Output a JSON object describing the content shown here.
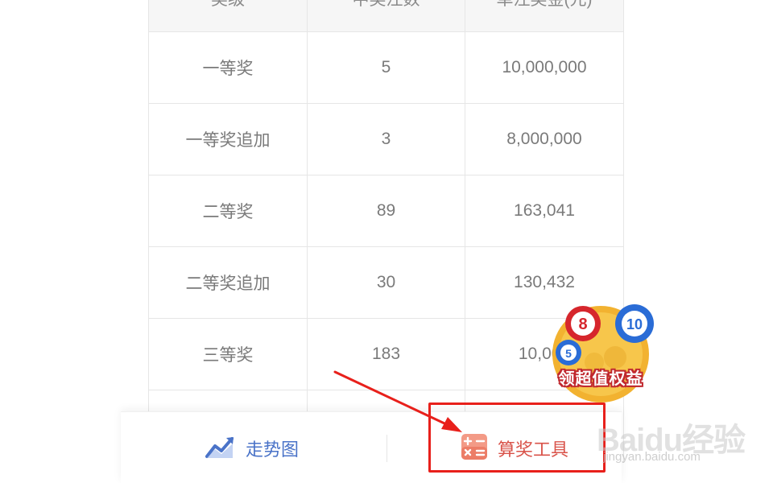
{
  "table": {
    "headers": [
      "奖级",
      "中奖注数",
      "单注奖金(元)"
    ],
    "rows": [
      [
        "一等奖",
        "5",
        "10,000,000"
      ],
      [
        "一等奖追加",
        "3",
        "8,000,000"
      ],
      [
        "二等奖",
        "89",
        "163,041"
      ],
      [
        "二等奖追加",
        "30",
        "130,432"
      ],
      [
        "三等奖",
        "183",
        "10,000"
      ],
      [
        "",
        "",
        ""
      ]
    ]
  },
  "bottom_bar": {
    "trend_label": "走势图",
    "calc_label": "算奖工具"
  },
  "promo": {
    "text": "领超值权益",
    "ball_numbers": [
      "8",
      "10",
      "5"
    ]
  },
  "watermark": {
    "brand": "Baidu经验",
    "site": "jingyan.baidu.com"
  },
  "colors": {
    "highlight": "#e8201b",
    "trend_icon": "#4a73c8",
    "calc_icon": "#f08a78"
  }
}
